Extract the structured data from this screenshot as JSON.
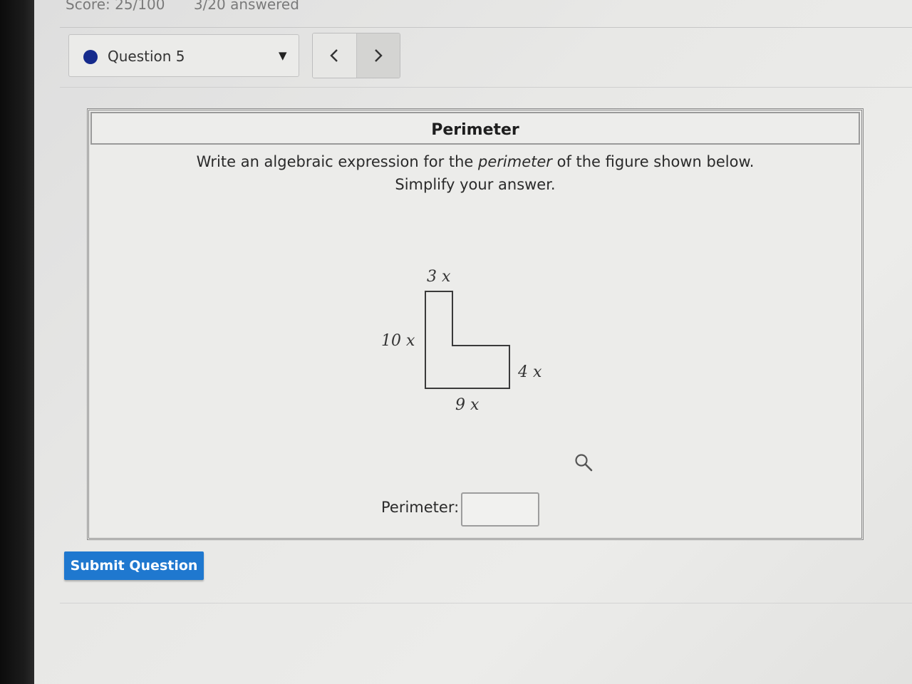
{
  "header": {
    "score": "Score: 25/100",
    "answered": "3/20 answered"
  },
  "question_nav": {
    "selected": "Question 5",
    "status_color": "#152a8c",
    "prev_icon": "chevron-left",
    "next_icon": "chevron-right"
  },
  "question": {
    "title": "Perimeter",
    "instruction_before": "Write an algebraic expression for the ",
    "instruction_emphasis": "perimeter",
    "instruction_after": " of the figure shown below.",
    "instruction_line2": "Simplify your answer.",
    "figure": {
      "shape": "L-shape",
      "labels": {
        "top": "3 x",
        "left": "10 x",
        "right": "4 x",
        "bottom": "9 x"
      }
    },
    "answer_label": "Perimeter:",
    "answer_value": ""
  },
  "actions": {
    "submit_label": "Submit Question",
    "submit_color": "#1f78cf"
  }
}
